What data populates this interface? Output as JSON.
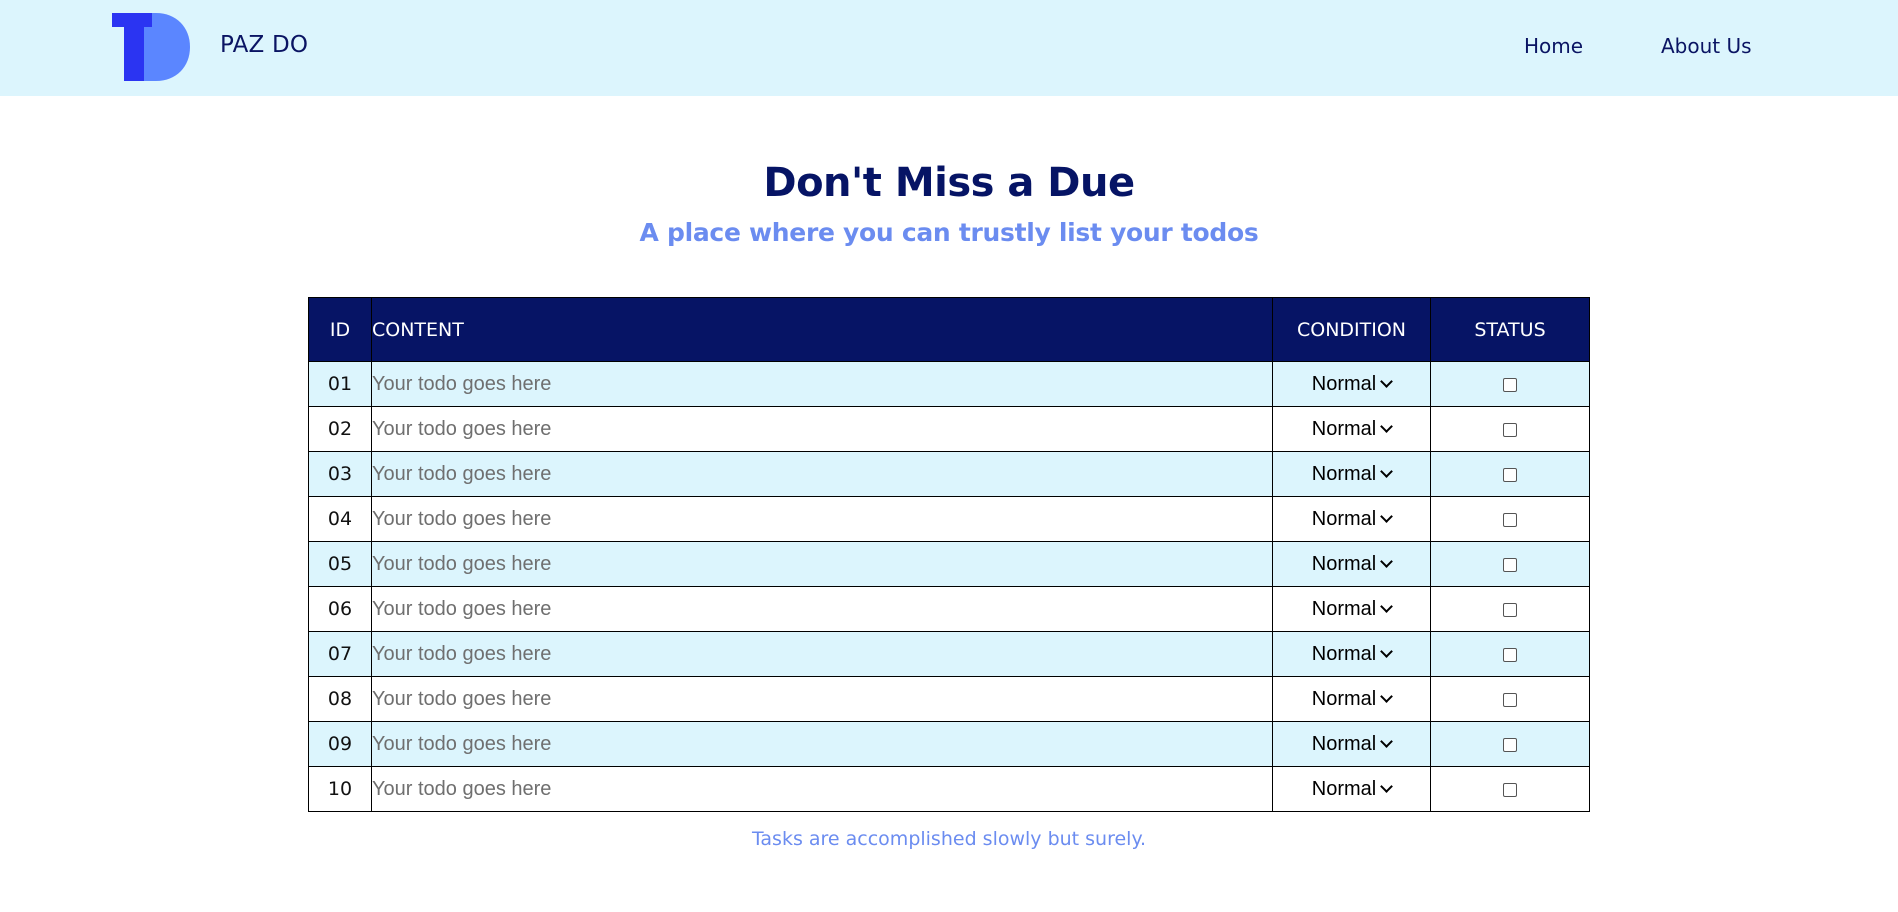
{
  "header": {
    "brand": "PAZ DO",
    "logo_colors": {
      "dark": "#2b34f2",
      "light": "#5b86ff"
    },
    "nav": [
      {
        "label": "Home"
      },
      {
        "label": "About Us"
      }
    ]
  },
  "hero": {
    "title": "Don't Miss a Due",
    "subtitle": "A place where you can trustly list your todos"
  },
  "table": {
    "headers": {
      "id": "ID",
      "content": "CONTENT",
      "condition": "CONDITION",
      "status": "STATUS"
    },
    "rows": [
      {
        "id": "01",
        "placeholder": "Your todo goes here",
        "condition": "Normal",
        "done": false
      },
      {
        "id": "02",
        "placeholder": "Your todo goes here",
        "condition": "Normal",
        "done": false
      },
      {
        "id": "03",
        "placeholder": "Your todo goes here",
        "condition": "Normal",
        "done": false
      },
      {
        "id": "04",
        "placeholder": "Your todo goes here",
        "condition": "Normal",
        "done": false
      },
      {
        "id": "05",
        "placeholder": "Your todo goes here",
        "condition": "Normal",
        "done": false
      },
      {
        "id": "06",
        "placeholder": "Your todo goes here",
        "condition": "Normal",
        "done": false
      },
      {
        "id": "07",
        "placeholder": "Your todo goes here",
        "condition": "Normal",
        "done": false
      },
      {
        "id": "08",
        "placeholder": "Your todo goes here",
        "condition": "Normal",
        "done": false
      },
      {
        "id": "09",
        "placeholder": "Your todo goes here",
        "condition": "Normal",
        "done": false
      },
      {
        "id": "10",
        "placeholder": "Your todo goes here",
        "condition": "Normal",
        "done": false
      }
    ]
  },
  "footer": {
    "text": "Tasks are accomplished slowly but surely."
  },
  "colors": {
    "navbar_bg": "#dcf5fd",
    "navy": "#061465",
    "accent": "#6b8cf0"
  }
}
